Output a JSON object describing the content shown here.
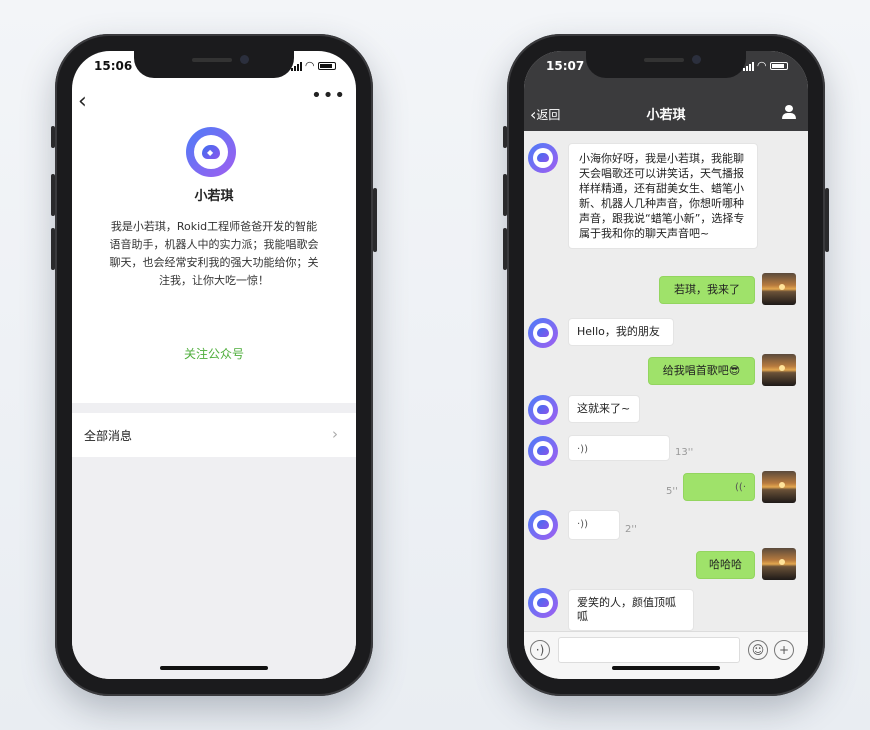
{
  "left_phone": {
    "status_time": "15:06",
    "nav": {
      "back_icon": "chevron-left",
      "more_icon": "more-dots",
      "more_glyph": "•••"
    },
    "profile": {
      "name": "小若琪",
      "description": "我是小若琪，Rokid工程师爸爸开发的智能语音助手，机器人中的实力派；我能唱歌会聊天，也会经常安利我的强大功能给你；关注我，让你大吃一惊！",
      "follow_label": "关注公众号"
    },
    "all_messages_label": "全部消息",
    "accent_color": "#4fae3c"
  },
  "right_phone": {
    "status_time": "15:07",
    "nav": {
      "back_label": "返回",
      "title": "小若琪",
      "user_icon": "user-icon"
    },
    "messages": [
      {
        "from": "bot",
        "type": "text",
        "text": "小海你好呀，我是小若琪，我能聊天会唱歌还可以讲笑话，天气播报样样精通，还有甜美女生、蜡笔小新、机器人几种声音，你想听哪种声音，跟我说“蜡笔小新”，选择专属于我和你的聊天声音吧~"
      },
      {
        "from": "me",
        "type": "text",
        "text": "若琪，我来了"
      },
      {
        "from": "bot",
        "type": "text",
        "text": "Hello，我的朋友"
      },
      {
        "from": "me",
        "type": "text",
        "text": "给我唱首歌吧😎"
      },
      {
        "from": "bot",
        "type": "text",
        "text": "这就来了~"
      },
      {
        "from": "bot",
        "type": "voice",
        "duration": "13''"
      },
      {
        "from": "me",
        "type": "voice",
        "duration": "5''"
      },
      {
        "from": "bot",
        "type": "voice",
        "duration": "2''"
      },
      {
        "from": "me",
        "type": "text",
        "text": "哈哈哈"
      },
      {
        "from": "bot",
        "type": "text",
        "text": "爱笑的人，颜值顶呱呱"
      }
    ],
    "input_bar": {
      "voice_icon": "voice-icon",
      "emoji_icon": "emoji-icon",
      "plus_icon": "plus-icon"
    },
    "my_bubble_color": "#9fe26a"
  }
}
